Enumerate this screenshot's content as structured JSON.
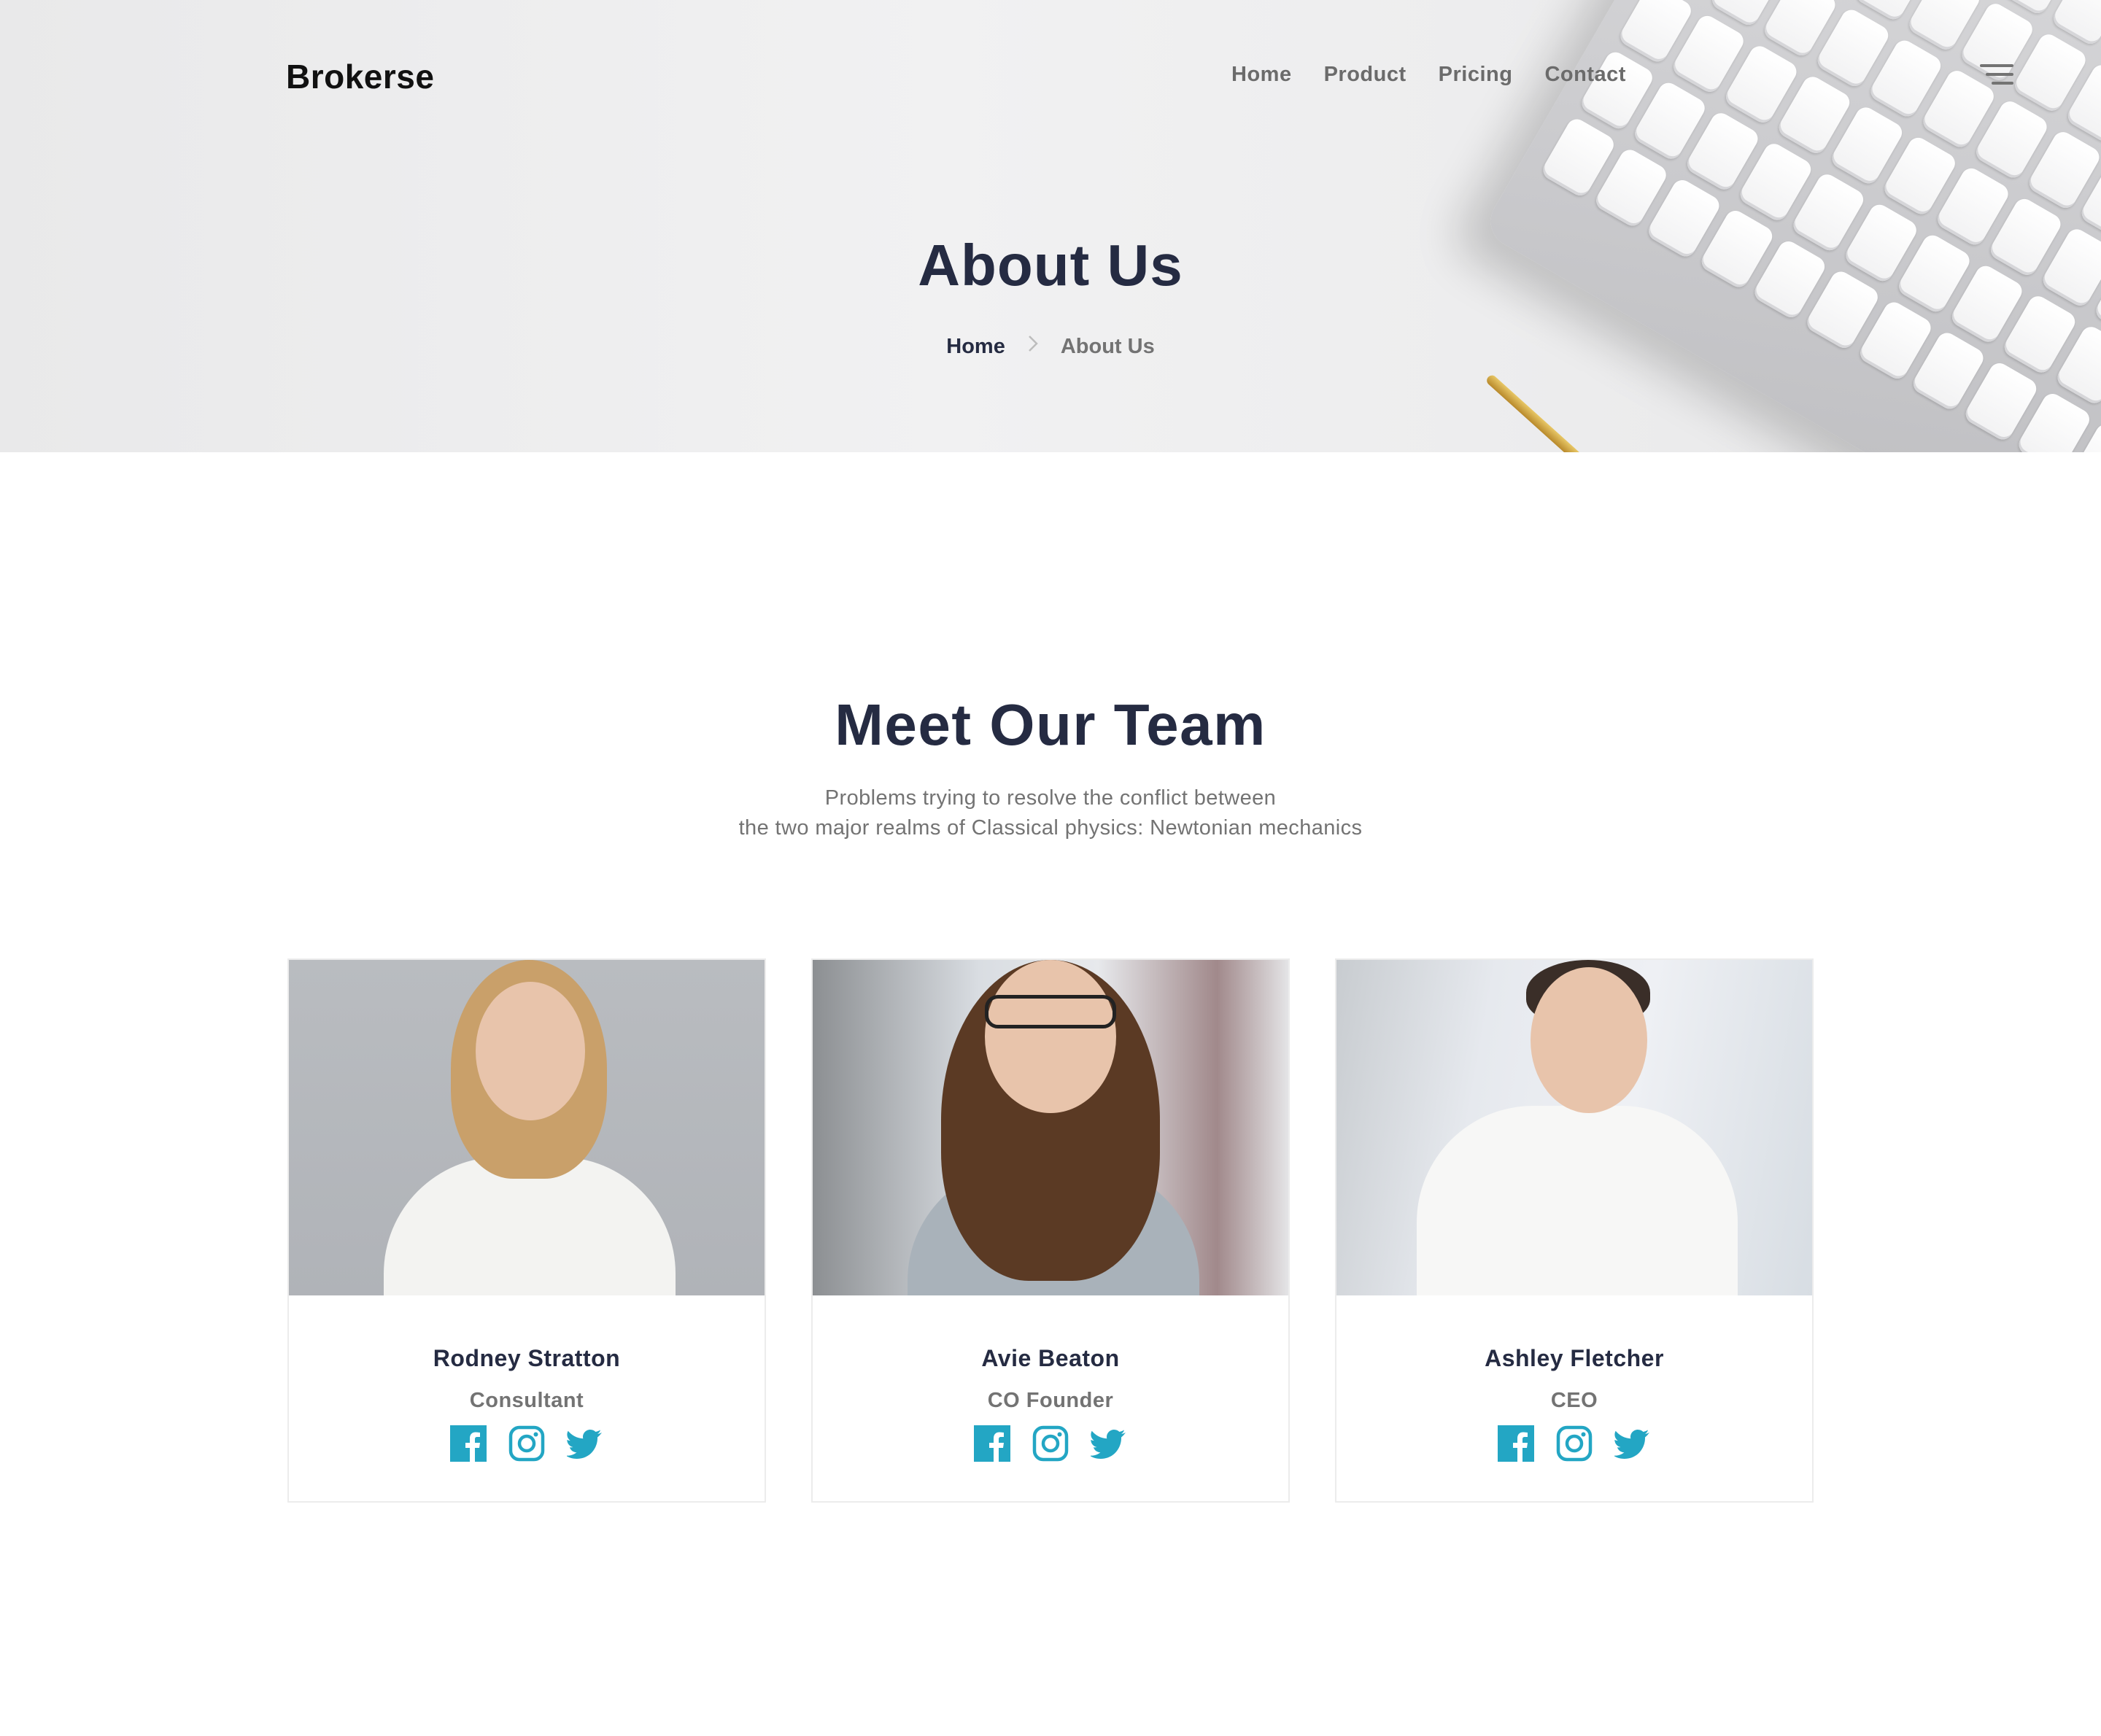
{
  "header": {
    "logo": "Brokerse",
    "nav": [
      "Home",
      "Product",
      "Pricing",
      "Contact"
    ]
  },
  "hero": {
    "title": "About Us",
    "breadcrumb": {
      "home": "Home",
      "current": "About Us"
    }
  },
  "team": {
    "title": "Meet Our Team",
    "subtitle_line1": "Problems trying to resolve the conflict between",
    "subtitle_line2": "the two major realms of Classical physics: Newtonian mechanics",
    "members": [
      {
        "name": "Rodney Stratton",
        "role": "Consultant"
      },
      {
        "name": "Avie Beaton",
        "role": "CO Founder"
      },
      {
        "name": "Ashley Fletcher",
        "role": "CEO"
      }
    ]
  },
  "icons": {
    "social": [
      "facebook-icon",
      "instagram-icon",
      "twitter-icon"
    ],
    "menu": "hamburger-icon"
  },
  "colors": {
    "heading": "#252b42",
    "muted": "#737373",
    "accent": "#23a6c4"
  }
}
